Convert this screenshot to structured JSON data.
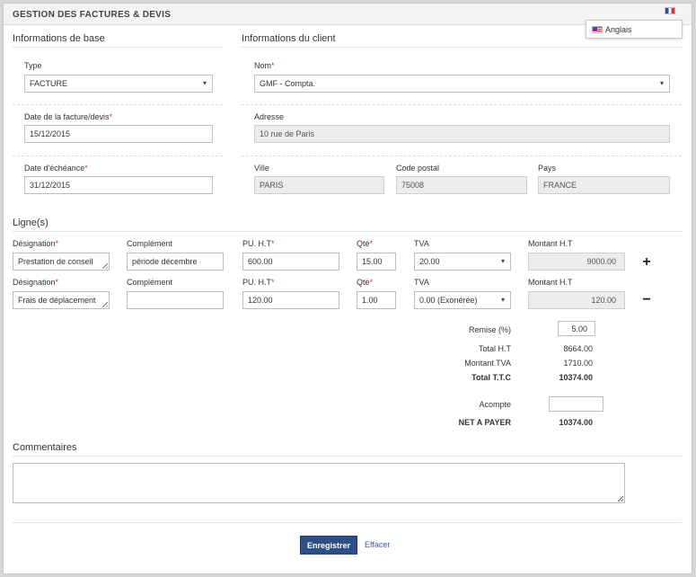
{
  "app": {
    "title": "GESTION DES FACTURES & DEVIS"
  },
  "language": {
    "current_flag": "flag-fr-icon",
    "menu_item": "Anglais",
    "menu_flag": "flag-us-icon"
  },
  "basic": {
    "heading": "Informations de base",
    "type_label": "Type",
    "type_value": "FACTURE",
    "date_label": "Date de la facture/devis",
    "date_value": "15/12/2015",
    "due_label": "Date d'échéance",
    "due_value": "31/12/2015"
  },
  "client": {
    "heading": "Informations du client",
    "name_label": "Nom",
    "name_value": "GMF - Compta.",
    "address_label": "Adresse",
    "address_value": "10 rue de Paris",
    "city_label": "Ville",
    "city_value": "PARIS",
    "zip_label": "Code postal",
    "zip_value": "75008",
    "country_label": "Pays",
    "country_value": "FRANCE"
  },
  "lines": {
    "heading": "Ligne(s)",
    "columns": {
      "designation": "Désignation",
      "complement": "Complément",
      "unit_price": "PU. H.T",
      "qty": "Qté",
      "vat": "TVA",
      "amount": "Montant H.T"
    },
    "rows": [
      {
        "designation": "Prestation de conseil",
        "complement": "période décembre",
        "unit_price": "600.00",
        "qty": "15.00",
        "vat": "20.00",
        "amount": "9000.00",
        "action": "+"
      },
      {
        "designation": "Frais de déplacement",
        "complement": "",
        "unit_price": "120.00",
        "qty": "1.00",
        "vat": "0.00 (Exonérée)",
        "amount": "120.00",
        "action": "−"
      }
    ]
  },
  "totals": {
    "discount_label": "Remise (%)",
    "discount_value": "5.00",
    "total_ht_label": "Total H.T",
    "total_ht_value": "8664.00",
    "vat_amount_label": "Montant TVA",
    "vat_amount_value": "1710.00",
    "total_ttc_label": "Total T.T.C",
    "total_ttc_value": "10374.00",
    "deposit_label": "Acompte",
    "deposit_value": "",
    "net_label": "NET A PAYER",
    "net_value": "10374.00"
  },
  "comments": {
    "heading": "Commentaires",
    "value": ""
  },
  "actions": {
    "save_label": "Enregistrer",
    "erase_label": "Effacer"
  },
  "colors": {
    "primary_button": "#2e4f83",
    "required_star": "#dd3333",
    "readonly_bg": "#ececec"
  }
}
